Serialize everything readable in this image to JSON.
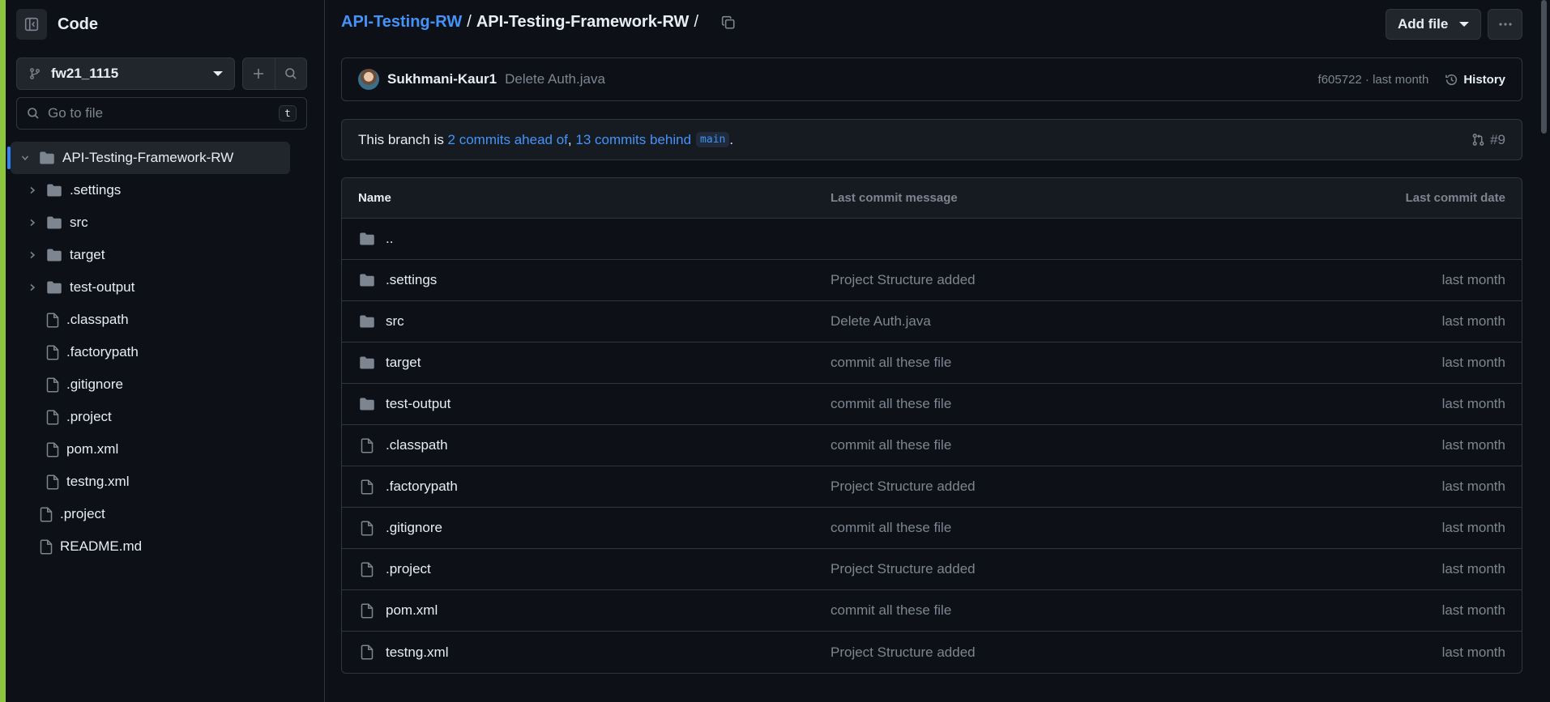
{
  "sidebar": {
    "title": "Code",
    "branch": "fw21_1115",
    "goto_placeholder": "Go to file",
    "goto_shortcut": "t",
    "tree": [
      {
        "label": "API-Testing-Framework-RW",
        "type": "folder",
        "expanded": true,
        "depth": 0,
        "active": true
      },
      {
        "label": ".settings",
        "type": "folder",
        "expanded": false,
        "depth": 1
      },
      {
        "label": "src",
        "type": "folder",
        "expanded": false,
        "depth": 1
      },
      {
        "label": "target",
        "type": "folder",
        "expanded": false,
        "depth": 1
      },
      {
        "label": "test-output",
        "type": "folder",
        "expanded": false,
        "depth": 1
      },
      {
        "label": ".classpath",
        "type": "file",
        "depth": 1
      },
      {
        "label": ".factorypath",
        "type": "file",
        "depth": 1
      },
      {
        "label": ".gitignore",
        "type": "file",
        "depth": 1
      },
      {
        "label": ".project",
        "type": "file",
        "depth": 1
      },
      {
        "label": "pom.xml",
        "type": "file",
        "depth": 1
      },
      {
        "label": "testng.xml",
        "type": "file",
        "depth": 1
      },
      {
        "label": ".project",
        "type": "file",
        "depth": 0
      },
      {
        "label": "README.md",
        "type": "file",
        "depth": 0
      }
    ]
  },
  "header": {
    "repo": "API-Testing-RW",
    "sep": "/",
    "folder": "API-Testing-Framework-RW",
    "trail": "/",
    "add_file": "Add file"
  },
  "commit": {
    "author": "Sukhmani-Kaur1",
    "message": "Delete Auth.java",
    "sha_time": "f605722 · last month",
    "history": "History"
  },
  "branch_status": {
    "prefix": "This branch is ",
    "ahead": "2 commits ahead of",
    "comma": ", ",
    "behind": "13 commits behind",
    "base": "main",
    "suffix": ".",
    "pr": "#9"
  },
  "table": {
    "headers": {
      "name": "Name",
      "message": "Last commit message",
      "date": "Last commit date"
    },
    "rows": [
      {
        "name": "..",
        "type": "folder",
        "message": "",
        "date": ""
      },
      {
        "name": ".settings",
        "type": "folder",
        "message": "Project Structure added",
        "date": "last month"
      },
      {
        "name": "src",
        "type": "folder",
        "message": "Delete Auth.java",
        "date": "last month"
      },
      {
        "name": "target",
        "type": "folder",
        "message": "commit all these file",
        "date": "last month"
      },
      {
        "name": "test-output",
        "type": "folder",
        "message": "commit all these file",
        "date": "last month"
      },
      {
        "name": ".classpath",
        "type": "file",
        "message": "commit all these file",
        "date": "last month"
      },
      {
        "name": ".factorypath",
        "type": "file",
        "message": "Project Structure added",
        "date": "last month"
      },
      {
        "name": ".gitignore",
        "type": "file",
        "message": "commit all these file",
        "date": "last month"
      },
      {
        "name": ".project",
        "type": "file",
        "message": "Project Structure added",
        "date": "last month"
      },
      {
        "name": "pom.xml",
        "type": "file",
        "message": "commit all these file",
        "date": "last month"
      },
      {
        "name": "testng.xml",
        "type": "file",
        "message": "Project Structure added",
        "date": "last month"
      }
    ]
  },
  "icons": [
    "sidebar-collapse-icon",
    "git-branch-icon",
    "plus-icon",
    "search-icon",
    "folder-icon",
    "file-icon",
    "chevron-right-icon",
    "chevron-down-icon",
    "copy-icon",
    "kebab-icon",
    "history-icon",
    "pull-request-icon"
  ],
  "colors": {
    "accent": "#4493f8",
    "background": "#0d1117",
    "muted": "#7d8590",
    "active_marker": "#2f81f7",
    "edge": "#8cc63f"
  }
}
